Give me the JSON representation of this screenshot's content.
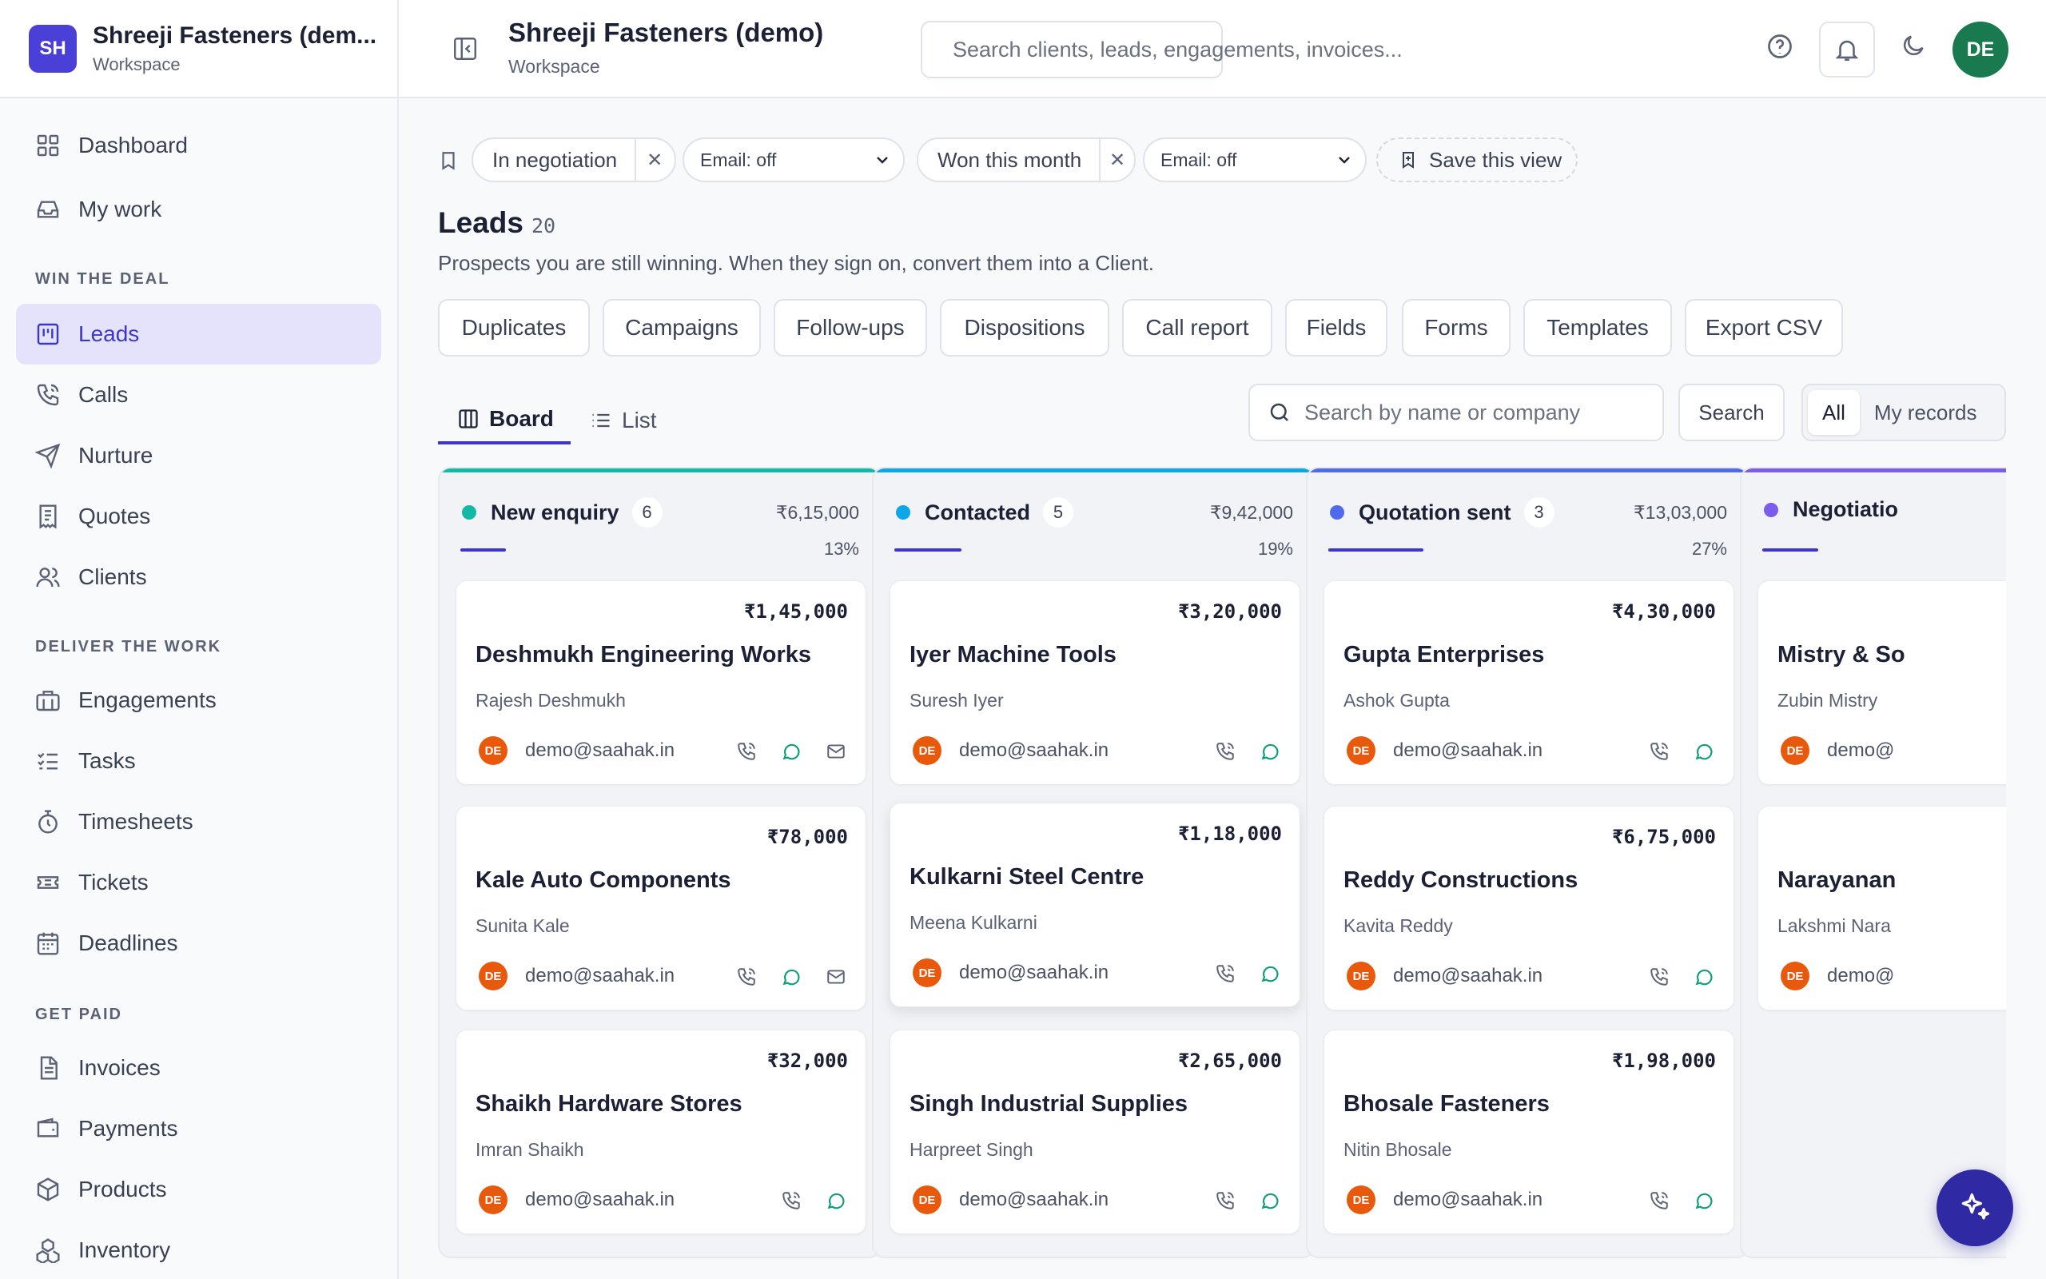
{
  "workspace": {
    "initials": "SH",
    "name": "Shreeji Fasteners (dem...",
    "subtitle": "Workspace"
  },
  "sidebar": {
    "top": [
      {
        "label": "Dashboard",
        "icon": "dashboard-grid-icon"
      },
      {
        "label": "My work",
        "icon": "inbox-icon"
      }
    ],
    "sections": [
      {
        "title": "WIN THE DEAL",
        "items": [
          {
            "label": "Leads",
            "icon": "kanban-icon",
            "active": true
          },
          {
            "label": "Calls",
            "icon": "phone-icon"
          },
          {
            "label": "Nurture",
            "icon": "send-icon"
          },
          {
            "label": "Quotes",
            "icon": "receipt-icon"
          },
          {
            "label": "Clients",
            "icon": "users-icon"
          }
        ]
      },
      {
        "title": "DELIVER THE WORK",
        "items": [
          {
            "label": "Engagements",
            "icon": "briefcase-icon"
          },
          {
            "label": "Tasks",
            "icon": "checklist-icon"
          },
          {
            "label": "Timesheets",
            "icon": "stopwatch-icon"
          },
          {
            "label": "Tickets",
            "icon": "ticket-icon"
          },
          {
            "label": "Deadlines",
            "icon": "calendar-icon"
          }
        ]
      },
      {
        "title": "GET PAID",
        "items": [
          {
            "label": "Invoices",
            "icon": "invoice-icon"
          },
          {
            "label": "Payments",
            "icon": "wallet-icon"
          },
          {
            "label": "Products",
            "icon": "box-icon"
          },
          {
            "label": "Inventory",
            "icon": "boxes-icon"
          }
        ]
      }
    ]
  },
  "topbar": {
    "title": "Shreeji Fasteners (demo)",
    "subtitle": "Workspace",
    "search_placeholder": "Search clients, leads, engagements, invoices...",
    "user_initials": "DE"
  },
  "filters": {
    "chips": [
      {
        "label": "In negotiation",
        "select": "Email: off"
      },
      {
        "label": "Won this month",
        "select": "Email: off"
      }
    ],
    "save_view": "Save this view"
  },
  "page": {
    "title": "Leads",
    "count": "20",
    "description": "Prospects you are still winning. When they sign on, convert them into a Client."
  },
  "tools": [
    "Duplicates",
    "Campaigns",
    "Follow-ups",
    "Dispositions",
    "Call report",
    "Fields",
    "Forms",
    "Templates",
    "Export CSV"
  ],
  "views": {
    "board": "Board",
    "list": "List"
  },
  "board_search": {
    "placeholder": "Search by name or company",
    "button": "Search"
  },
  "scope": {
    "all": "All",
    "mine": "My records"
  },
  "columns": [
    {
      "name": "New enquiry",
      "count": "6",
      "total": "₹6,15,000",
      "percent": "13%",
      "progress": 0.13,
      "color": "#14b8a6",
      "cards": [
        {
          "amount": "₹1,45,000",
          "company": "Deshmukh Engineering Works",
          "person": "Rajesh Deshmukh",
          "email": "demo@saahak.in",
          "owner": "DE",
          "actions": [
            "phone",
            "chat",
            "mail"
          ]
        },
        {
          "amount": "₹78,000",
          "company": "Kale Auto Components",
          "person": "Sunita Kale",
          "email": "demo@saahak.in",
          "owner": "DE",
          "actions": [
            "phone",
            "chat",
            "mail"
          ]
        },
        {
          "amount": "₹32,000",
          "company": "Shaikh Hardware Stores",
          "person": "Imran Shaikh",
          "email": "demo@saahak.in",
          "owner": "DE",
          "actions": [
            "phone",
            "chat"
          ]
        }
      ]
    },
    {
      "name": "Contacted",
      "count": "5",
      "total": "₹9,42,000",
      "percent": "19%",
      "progress": 0.19,
      "color": "#0ea5e9",
      "cards": [
        {
          "amount": "₹3,20,000",
          "company": "Iyer Machine Tools",
          "person": "Suresh Iyer",
          "email": "demo@saahak.in",
          "owner": "DE",
          "actions": [
            "phone",
            "chat"
          ]
        },
        {
          "amount": "₹1,18,000",
          "company": "Kulkarni Steel Centre",
          "person": "Meena Kulkarni",
          "email": "demo@saahak.in",
          "owner": "DE",
          "actions": [
            "phone",
            "chat"
          ]
        },
        {
          "amount": "₹2,65,000",
          "company": "Singh Industrial Supplies",
          "person": "Harpreet Singh",
          "email": "demo@saahak.in",
          "owner": "DE",
          "actions": [
            "phone",
            "chat"
          ]
        }
      ]
    },
    {
      "name": "Quotation sent",
      "count": "3",
      "total": "₹13,03,000",
      "percent": "27%",
      "progress": 0.27,
      "color": "#4f6bed",
      "cards": [
        {
          "amount": "₹4,30,000",
          "company": "Gupta Enterprises",
          "person": "Ashok Gupta",
          "email": "demo@saahak.in",
          "owner": "DE",
          "actions": [
            "phone",
            "chat"
          ]
        },
        {
          "amount": "₹6,75,000",
          "company": "Reddy Constructions",
          "person": "Kavita Reddy",
          "email": "demo@saahak.in",
          "owner": "DE",
          "actions": [
            "phone",
            "chat"
          ]
        },
        {
          "amount": "₹1,98,000",
          "company": "Bhosale Fasteners",
          "person": "Nitin Bhosale",
          "email": "demo@saahak.in",
          "owner": "DE",
          "actions": [
            "phone",
            "chat"
          ]
        }
      ]
    },
    {
      "name": "Negotiatio",
      "count": "",
      "total": "",
      "percent": "",
      "progress": 0.16,
      "color": "#7c5cf0",
      "cards": [
        {
          "amount": "",
          "company": "Mistry & So",
          "person": "Zubin Mistry",
          "email": "demo@",
          "owner": "DE",
          "actions": []
        },
        {
          "amount": "",
          "company": "Narayanan",
          "person": "Lakshmi Nara",
          "email": "demo@",
          "owner": "DE",
          "actions": []
        }
      ]
    }
  ],
  "colors": {
    "accent": "#3d36c8",
    "brand": "#4a3fd6",
    "fab": "#2f2aa3",
    "owner_avatar": "#e8590c",
    "user_avatar": "#1a7a4f",
    "chat_icon": "#0f9d7a"
  },
  "fab": {
    "icon": "sparkles-icon"
  }
}
